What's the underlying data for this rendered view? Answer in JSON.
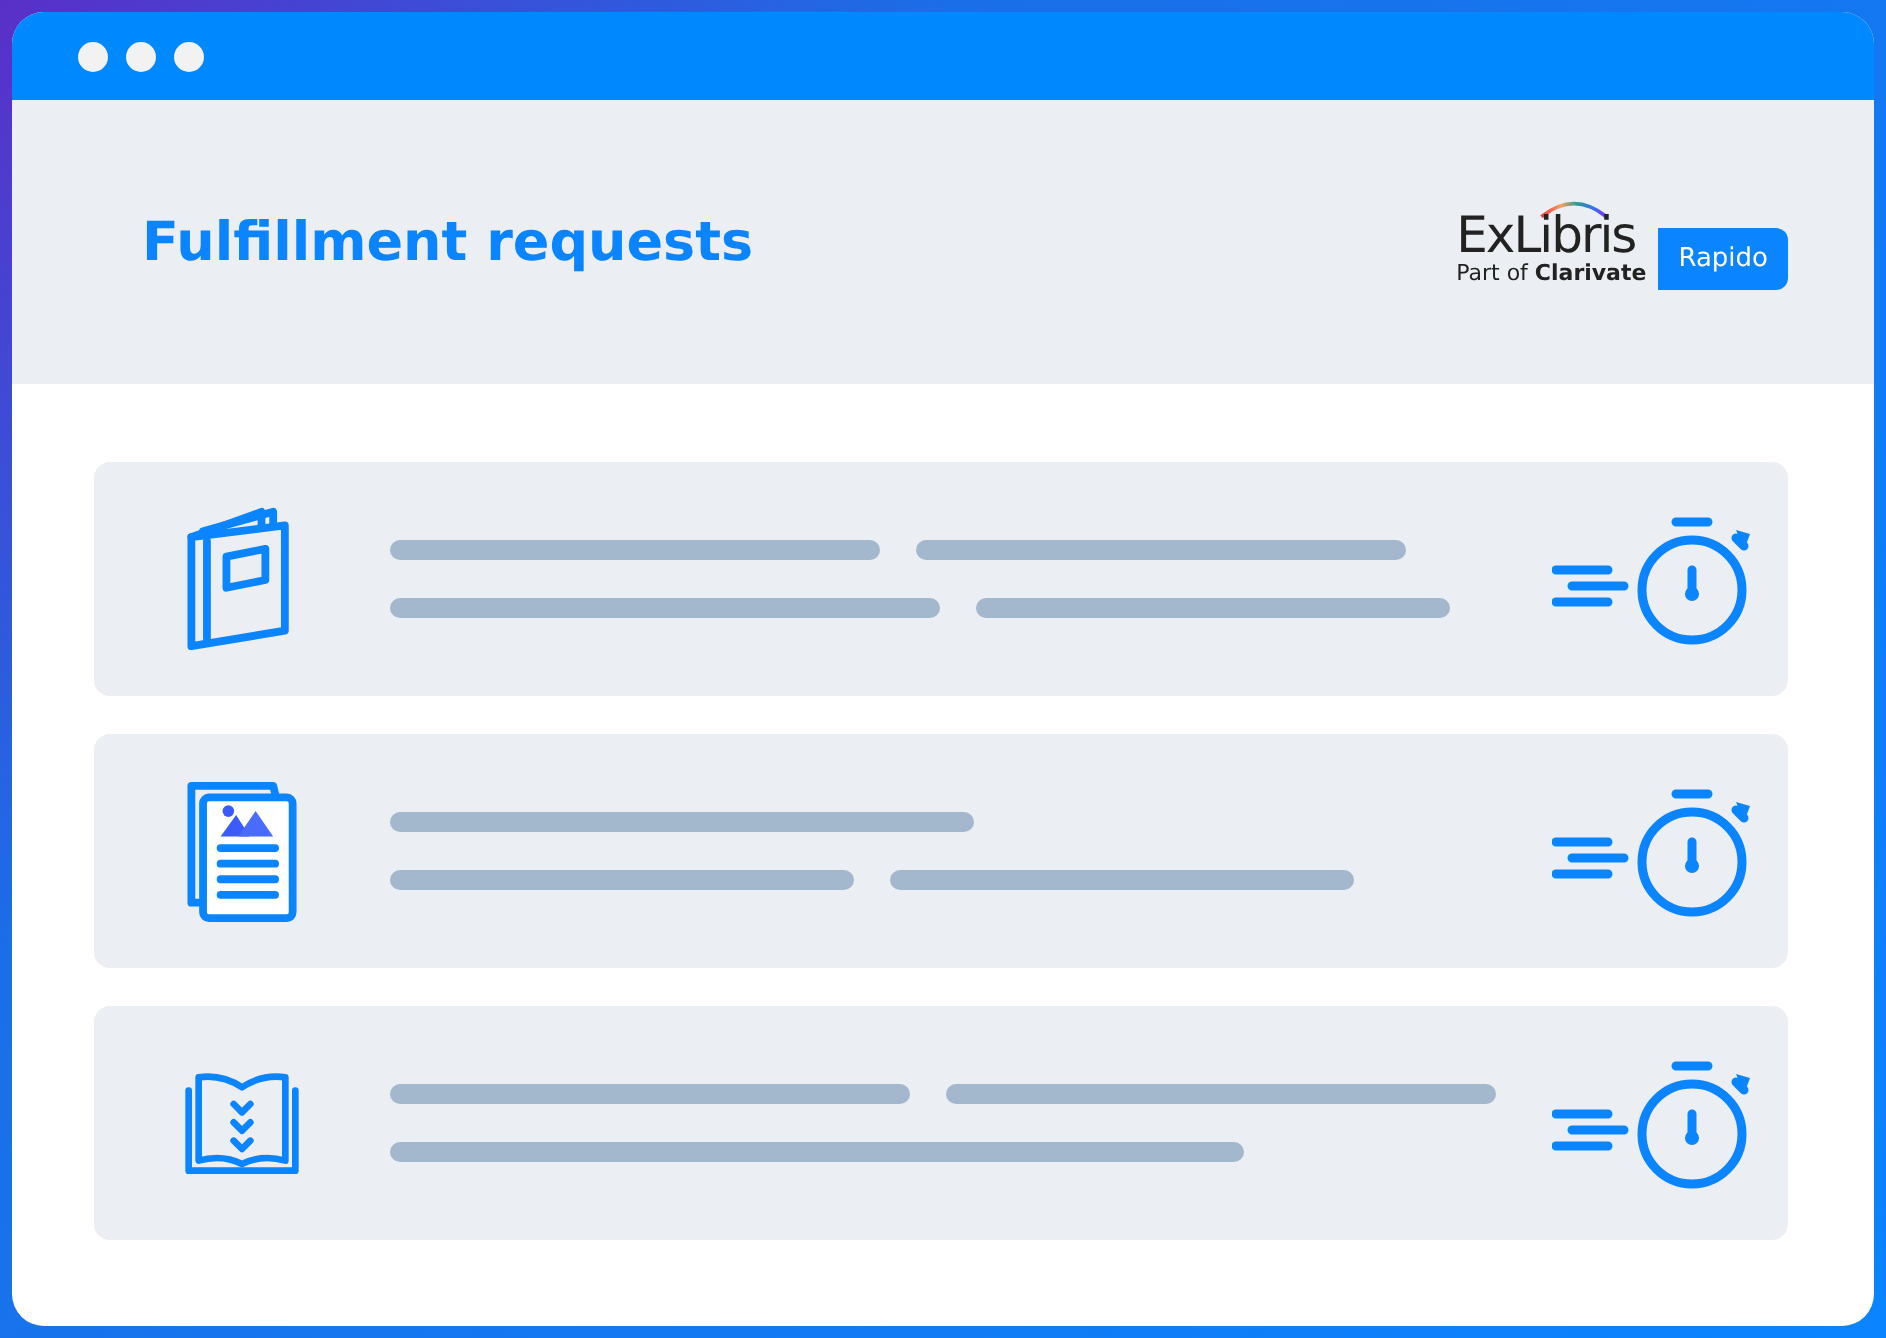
{
  "header": {
    "title": "Fulfillment requests",
    "logo": {
      "name": "ExLibris",
      "tagline_prefix": "Part of",
      "tagline_brand": "Clarivate"
    },
    "badge": "Rapido"
  },
  "requests": [
    {
      "kind": "book"
    },
    {
      "kind": "document"
    },
    {
      "kind": "open-book"
    }
  ]
}
